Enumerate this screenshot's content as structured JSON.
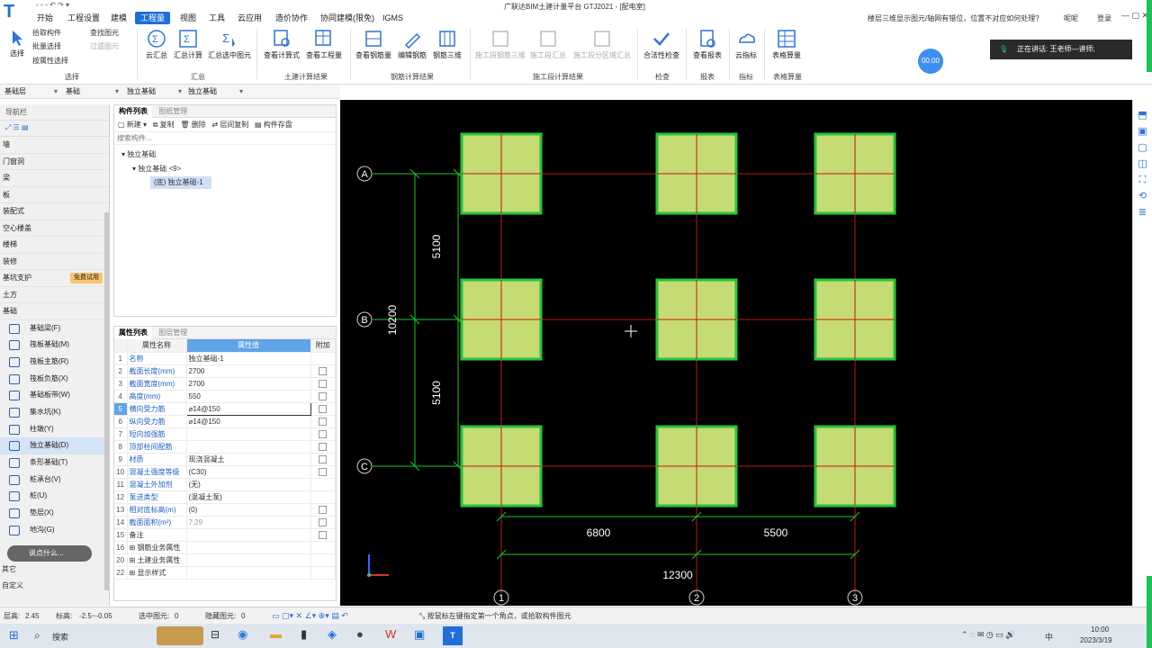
{
  "title": {
    "app": "广联达BIM土建计量平台 GTJ2021 - [配电室]",
    "menus": [
      "开始",
      "工程设置",
      "建模",
      "工程量",
      "视图",
      "工具",
      "云应用",
      "造价协作",
      "协同建模(限免)",
      "IGMS"
    ],
    "active_menu": "工程量",
    "question": "楼层三维显示图元/轴网有错位，位置不对应如何处理?",
    "right_items": [
      "呢呢",
      "登录"
    ]
  },
  "ribbon": {
    "select_group": {
      "big": "选择",
      "items": [
        "拾取构件",
        "批量选择",
        "按属性选择"
      ],
      "items2": [
        "查找图元",
        "过滤图元"
      ],
      "label": "选择"
    },
    "summary_group": {
      "items": [
        "云汇总",
        "汇总计算",
        "汇总选中图元"
      ],
      "label": "汇总"
    },
    "civil_group": {
      "items": [
        "查看计算式",
        "查看工程量"
      ],
      "label": "土建计算结果"
    },
    "rebar_group": {
      "items": [
        "查看钢筋量",
        "编辑钢筋",
        "钢筋三维"
      ],
      "label": "钢筋计算结果"
    },
    "construction_group": {
      "items": [
        "施工段钢筋三维",
        "施工段汇总",
        "施工段分区域汇总"
      ],
      "label": "施工段计算结果"
    },
    "check_group": {
      "items": [
        "合法性检查"
      ],
      "label": "检查"
    },
    "report_group": {
      "items": [
        "查看报表"
      ],
      "label": "报表"
    },
    "index_group": {
      "items": [
        "云指标"
      ],
      "label": "指标"
    },
    "table_group": {
      "items": [
        "表格算量"
      ],
      "label": "表格算量"
    },
    "timer": "00:00",
    "speaking": "正在讲话: 王老师—讲师;"
  },
  "filters": [
    "基础层",
    "基础",
    "独立基础",
    "独立基础"
  ],
  "nav": {
    "title": "导航栏",
    "categories": [
      "墙",
      "门窗洞",
      "梁",
      "板",
      "装配式",
      "空心楼盖",
      "楼梯",
      "装修",
      "基坑支护",
      "土方",
      "基础"
    ],
    "trial_badge": "免费试用",
    "subitems": [
      "基础梁(F)",
      "筏板基础(M)",
      "筏板主筋(R)",
      "筏板负筋(X)",
      "基础板带(W)",
      "集水坑(K)",
      "柱墩(Y)",
      "独立基础(D)",
      "条形基础(T)",
      "桩承台(V)",
      "桩(U)",
      "垫层(X)",
      "地沟(G)"
    ],
    "selected_sub": "独立基础(D)",
    "footer": [
      "其它",
      "自定义"
    ],
    "chat_placeholder": "说点什么..."
  },
  "components": {
    "tabs": [
      "构件列表",
      "图纸管理"
    ],
    "toolbar": [
      "新建",
      "复制",
      "删除",
      "层间复制",
      "构件存盘"
    ],
    "search_placeholder": "搜索构件...",
    "tree": [
      "独立基础",
      "独立基础 <9>",
      "(底) 独立基础-1"
    ]
  },
  "properties": {
    "tabs": [
      "属性列表",
      "图层管理"
    ],
    "headers": [
      "属性名称",
      "属性值",
      "附加"
    ],
    "rows": [
      {
        "num": "1",
        "name": "名称",
        "value": "独立基础-1",
        "cb": false
      },
      {
        "num": "2",
        "name": "截面长度(mm)",
        "value": "2700",
        "cb": true
      },
      {
        "num": "3",
        "name": "截面宽度(mm)",
        "value": "2700",
        "cb": true
      },
      {
        "num": "4",
        "name": "高度(mm)",
        "value": "550",
        "cb": true
      },
      {
        "num": "5",
        "name": "横向受力筋",
        "value": "⌀14@150",
        "cb": true
      },
      {
        "num": "6",
        "name": "纵向受力筋",
        "value": "⌀14@150",
        "cb": true
      },
      {
        "num": "7",
        "name": "短向加强筋",
        "value": "",
        "cb": true
      },
      {
        "num": "8",
        "name": "顶部柱间配筋",
        "value": "",
        "cb": true
      },
      {
        "num": "9",
        "name": "材质",
        "value": "现浇混凝土",
        "cb": true
      },
      {
        "num": "10",
        "name": "混凝土强度等级",
        "value": "(C30)",
        "cb": true
      },
      {
        "num": "11",
        "name": "混凝土外加剂",
        "value": "(无)",
        "cb": false
      },
      {
        "num": "12",
        "name": "泵送类型",
        "value": "(混凝土泵)",
        "cb": false
      },
      {
        "num": "13",
        "name": "相对底标高(m)",
        "value": "(0)",
        "cb": true
      },
      {
        "num": "14",
        "name": "截面面积(m²)",
        "value": "7.29",
        "cb": true
      },
      {
        "num": "15",
        "name": "备注",
        "value": "",
        "cb": true
      },
      {
        "num": "16",
        "name": "钢筋业务属性",
        "value": "",
        "cb": false
      },
      {
        "num": "20",
        "name": "土建业务属性",
        "value": "",
        "cb": false
      },
      {
        "num": "22",
        "name": "显示样式",
        "value": "",
        "cb": false
      }
    ]
  },
  "drawing": {
    "axes_letters": [
      "A",
      "B",
      "C"
    ],
    "axes_numbers": [
      "1",
      "2",
      "3"
    ],
    "dims": {
      "top": "5100",
      "bottom": "5100",
      "total_v": "10200",
      "left_h": "6800",
      "right_h": "5500",
      "total_h": "12300"
    },
    "colors": {
      "footing_fill": "#c5dc74",
      "footing_border": "#27c43a",
      "axis": "#c81414",
      "dim": "#17c82a"
    }
  },
  "status": {
    "layer_height_label": "层高:",
    "layer_height": "2.45",
    "elevation_label": "标高:",
    "elevation": "-2.5~-0.05",
    "selected_label": "选中图元:",
    "selected": "0",
    "hidden_label": "隐藏图元:",
    "hidden": "0",
    "hint": "按鼠标左键指定第一个角点，或拾取构件图元"
  },
  "taskbar": {
    "search": "搜索",
    "tray": [
      "中"
    ],
    "time": "10:00",
    "date": "2023/3/19"
  }
}
